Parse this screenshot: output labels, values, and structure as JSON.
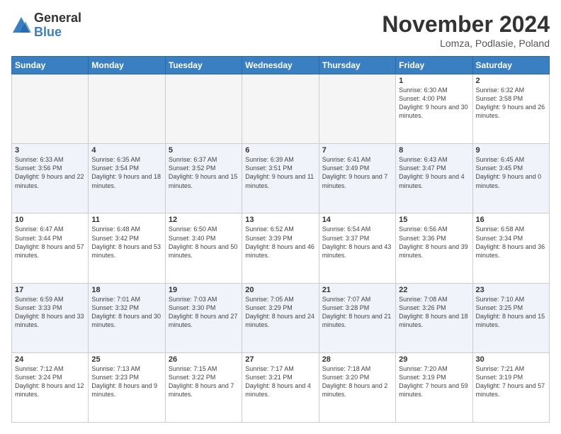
{
  "logo": {
    "general": "General",
    "blue": "Blue"
  },
  "header": {
    "month_year": "November 2024",
    "location": "Lomza, Podlasie, Poland"
  },
  "weekdays": [
    "Sunday",
    "Monday",
    "Tuesday",
    "Wednesday",
    "Thursday",
    "Friday",
    "Saturday"
  ],
  "weeks": [
    [
      {
        "day": "",
        "info": ""
      },
      {
        "day": "",
        "info": ""
      },
      {
        "day": "",
        "info": ""
      },
      {
        "day": "",
        "info": ""
      },
      {
        "day": "",
        "info": ""
      },
      {
        "day": "1",
        "info": "Sunrise: 6:30 AM\nSunset: 4:00 PM\nDaylight: 9 hours and 30 minutes."
      },
      {
        "day": "2",
        "info": "Sunrise: 6:32 AM\nSunset: 3:58 PM\nDaylight: 9 hours and 26 minutes."
      }
    ],
    [
      {
        "day": "3",
        "info": "Sunrise: 6:33 AM\nSunset: 3:56 PM\nDaylight: 9 hours and 22 minutes."
      },
      {
        "day": "4",
        "info": "Sunrise: 6:35 AM\nSunset: 3:54 PM\nDaylight: 9 hours and 18 minutes."
      },
      {
        "day": "5",
        "info": "Sunrise: 6:37 AM\nSunset: 3:52 PM\nDaylight: 9 hours and 15 minutes."
      },
      {
        "day": "6",
        "info": "Sunrise: 6:39 AM\nSunset: 3:51 PM\nDaylight: 9 hours and 11 minutes."
      },
      {
        "day": "7",
        "info": "Sunrise: 6:41 AM\nSunset: 3:49 PM\nDaylight: 9 hours and 7 minutes."
      },
      {
        "day": "8",
        "info": "Sunrise: 6:43 AM\nSunset: 3:47 PM\nDaylight: 9 hours and 4 minutes."
      },
      {
        "day": "9",
        "info": "Sunrise: 6:45 AM\nSunset: 3:45 PM\nDaylight: 9 hours and 0 minutes."
      }
    ],
    [
      {
        "day": "10",
        "info": "Sunrise: 6:47 AM\nSunset: 3:44 PM\nDaylight: 8 hours and 57 minutes."
      },
      {
        "day": "11",
        "info": "Sunrise: 6:48 AM\nSunset: 3:42 PM\nDaylight: 8 hours and 53 minutes."
      },
      {
        "day": "12",
        "info": "Sunrise: 6:50 AM\nSunset: 3:40 PM\nDaylight: 8 hours and 50 minutes."
      },
      {
        "day": "13",
        "info": "Sunrise: 6:52 AM\nSunset: 3:39 PM\nDaylight: 8 hours and 46 minutes."
      },
      {
        "day": "14",
        "info": "Sunrise: 6:54 AM\nSunset: 3:37 PM\nDaylight: 8 hours and 43 minutes."
      },
      {
        "day": "15",
        "info": "Sunrise: 6:56 AM\nSunset: 3:36 PM\nDaylight: 8 hours and 39 minutes."
      },
      {
        "day": "16",
        "info": "Sunrise: 6:58 AM\nSunset: 3:34 PM\nDaylight: 8 hours and 36 minutes."
      }
    ],
    [
      {
        "day": "17",
        "info": "Sunrise: 6:59 AM\nSunset: 3:33 PM\nDaylight: 8 hours and 33 minutes."
      },
      {
        "day": "18",
        "info": "Sunrise: 7:01 AM\nSunset: 3:32 PM\nDaylight: 8 hours and 30 minutes."
      },
      {
        "day": "19",
        "info": "Sunrise: 7:03 AM\nSunset: 3:30 PM\nDaylight: 8 hours and 27 minutes."
      },
      {
        "day": "20",
        "info": "Sunrise: 7:05 AM\nSunset: 3:29 PM\nDaylight: 8 hours and 24 minutes."
      },
      {
        "day": "21",
        "info": "Sunrise: 7:07 AM\nSunset: 3:28 PM\nDaylight: 8 hours and 21 minutes."
      },
      {
        "day": "22",
        "info": "Sunrise: 7:08 AM\nSunset: 3:26 PM\nDaylight: 8 hours and 18 minutes."
      },
      {
        "day": "23",
        "info": "Sunrise: 7:10 AM\nSunset: 3:25 PM\nDaylight: 8 hours and 15 minutes."
      }
    ],
    [
      {
        "day": "24",
        "info": "Sunrise: 7:12 AM\nSunset: 3:24 PM\nDaylight: 8 hours and 12 minutes."
      },
      {
        "day": "25",
        "info": "Sunrise: 7:13 AM\nSunset: 3:23 PM\nDaylight: 8 hours and 9 minutes."
      },
      {
        "day": "26",
        "info": "Sunrise: 7:15 AM\nSunset: 3:22 PM\nDaylight: 8 hours and 7 minutes."
      },
      {
        "day": "27",
        "info": "Sunrise: 7:17 AM\nSunset: 3:21 PM\nDaylight: 8 hours and 4 minutes."
      },
      {
        "day": "28",
        "info": "Sunrise: 7:18 AM\nSunset: 3:20 PM\nDaylight: 8 hours and 2 minutes."
      },
      {
        "day": "29",
        "info": "Sunrise: 7:20 AM\nSunset: 3:19 PM\nDaylight: 7 hours and 59 minutes."
      },
      {
        "day": "30",
        "info": "Sunrise: 7:21 AM\nSunset: 3:19 PM\nDaylight: 7 hours and 57 minutes."
      }
    ]
  ]
}
